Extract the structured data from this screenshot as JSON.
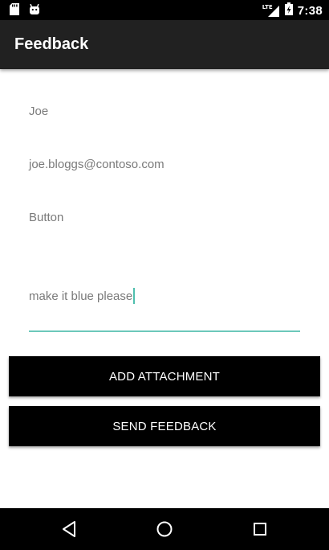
{
  "status_bar": {
    "time": "7:38",
    "network_label": "LTE",
    "icons": [
      "sd-card-icon",
      "android-debug-icon",
      "signal-icon",
      "battery-charging-icon"
    ]
  },
  "app_bar": {
    "title": "Feedback"
  },
  "form": {
    "name": "Joe",
    "email": "joe.bloggs@contoso.com",
    "subject": "Button",
    "message": "make it blue please"
  },
  "buttons": {
    "add_attachment": "ADD ATTACHMENT",
    "send_feedback": "SEND FEEDBACK"
  },
  "nav_bar": {
    "icons": [
      "back-icon",
      "home-icon",
      "recents-icon"
    ]
  },
  "colors": {
    "status_bar": "#000000",
    "app_bar": "#212121",
    "accent": "#6cc8ba",
    "button_bg": "#000000",
    "button_text": "#ffffff",
    "field_text": "#7a7a7a"
  }
}
